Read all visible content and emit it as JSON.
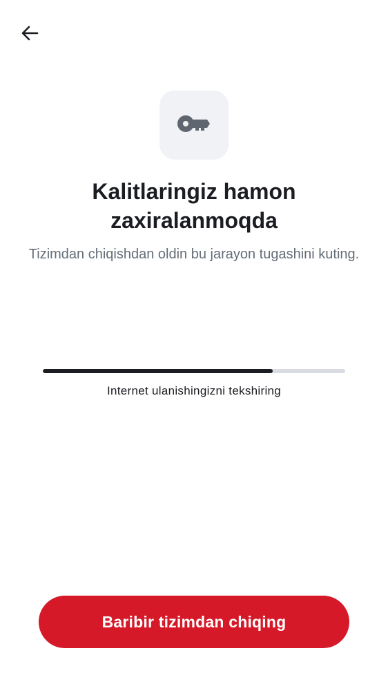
{
  "header": {
    "back_icon": "arrow-left-icon"
  },
  "hero": {
    "icon": "key-icon",
    "icon_color": "#5f6670",
    "tile_color": "#f0f2f5"
  },
  "title": "Kalitlaringiz hamon zaxiralanmoqda",
  "subtitle": "Tizimdan chiqishdan oldin bu jarayon tugashini kuting.",
  "progress": {
    "fraction": 0.76,
    "status_text": "Internet ulanishingizni tekshiring"
  },
  "actions": {
    "signout_label": "Baribir tizimdan chiqing",
    "signout_color": "#d51928"
  }
}
